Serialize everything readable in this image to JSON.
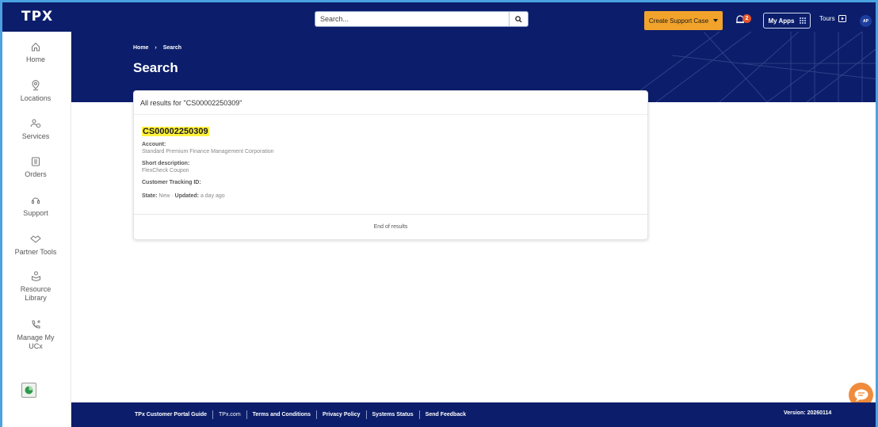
{
  "header": {
    "logo": "TPX",
    "search": {
      "placeholder": "Search...",
      "value": ""
    },
    "create_support_case": "Create Support Case",
    "notification_count": "2",
    "my_apps": "My Apps",
    "tours": "Tours",
    "avatar_initials": "AP"
  },
  "sidebar": {
    "items": [
      {
        "label": "Home",
        "icon": "home-icon"
      },
      {
        "label": "Locations",
        "icon": "location-pin-icon"
      },
      {
        "label": "Services",
        "icon": "services-icon"
      },
      {
        "label": "Orders",
        "icon": "orders-icon"
      },
      {
        "label": "Support",
        "icon": "support-icon"
      },
      {
        "label": "Partner Tools",
        "icon": "handshake-icon"
      },
      {
        "label": "Resource Library",
        "icon": "resource-library-icon"
      },
      {
        "label": "Manage My UCx",
        "icon": "phone-plus-icon"
      }
    ]
  },
  "banner": {
    "breadcrumb": [
      "Home",
      "Search"
    ],
    "title": "Search"
  },
  "results": {
    "header": "All results for \"CS00002250309\"",
    "items": [
      {
        "id": "CS00002250309",
        "account_label": "Account:",
        "account_value": "Standard Premium Finance Management Corporation",
        "short_desc_label": "Short description:",
        "short_desc_value": "FlexCheck Coupon",
        "tracking_label": "Customer Tracking ID:",
        "state_label": "State:",
        "state_value": "New",
        "updated_label": "Updated:",
        "updated_value": "a day ago"
      }
    ],
    "end_text": "End of results"
  },
  "footer": {
    "links": [
      "TPx Customer Portal Guide",
      "TPx.com",
      "Terms and Conditions",
      "Privacy Policy",
      "Systems Status",
      "Send Feedback"
    ],
    "version": "Version: 20260114"
  },
  "colors": {
    "navy": "#0c1e6b",
    "accent_orange": "#f2a32b",
    "highlight_yellow": "#fff23a",
    "chat_orange": "#f08b3c"
  }
}
